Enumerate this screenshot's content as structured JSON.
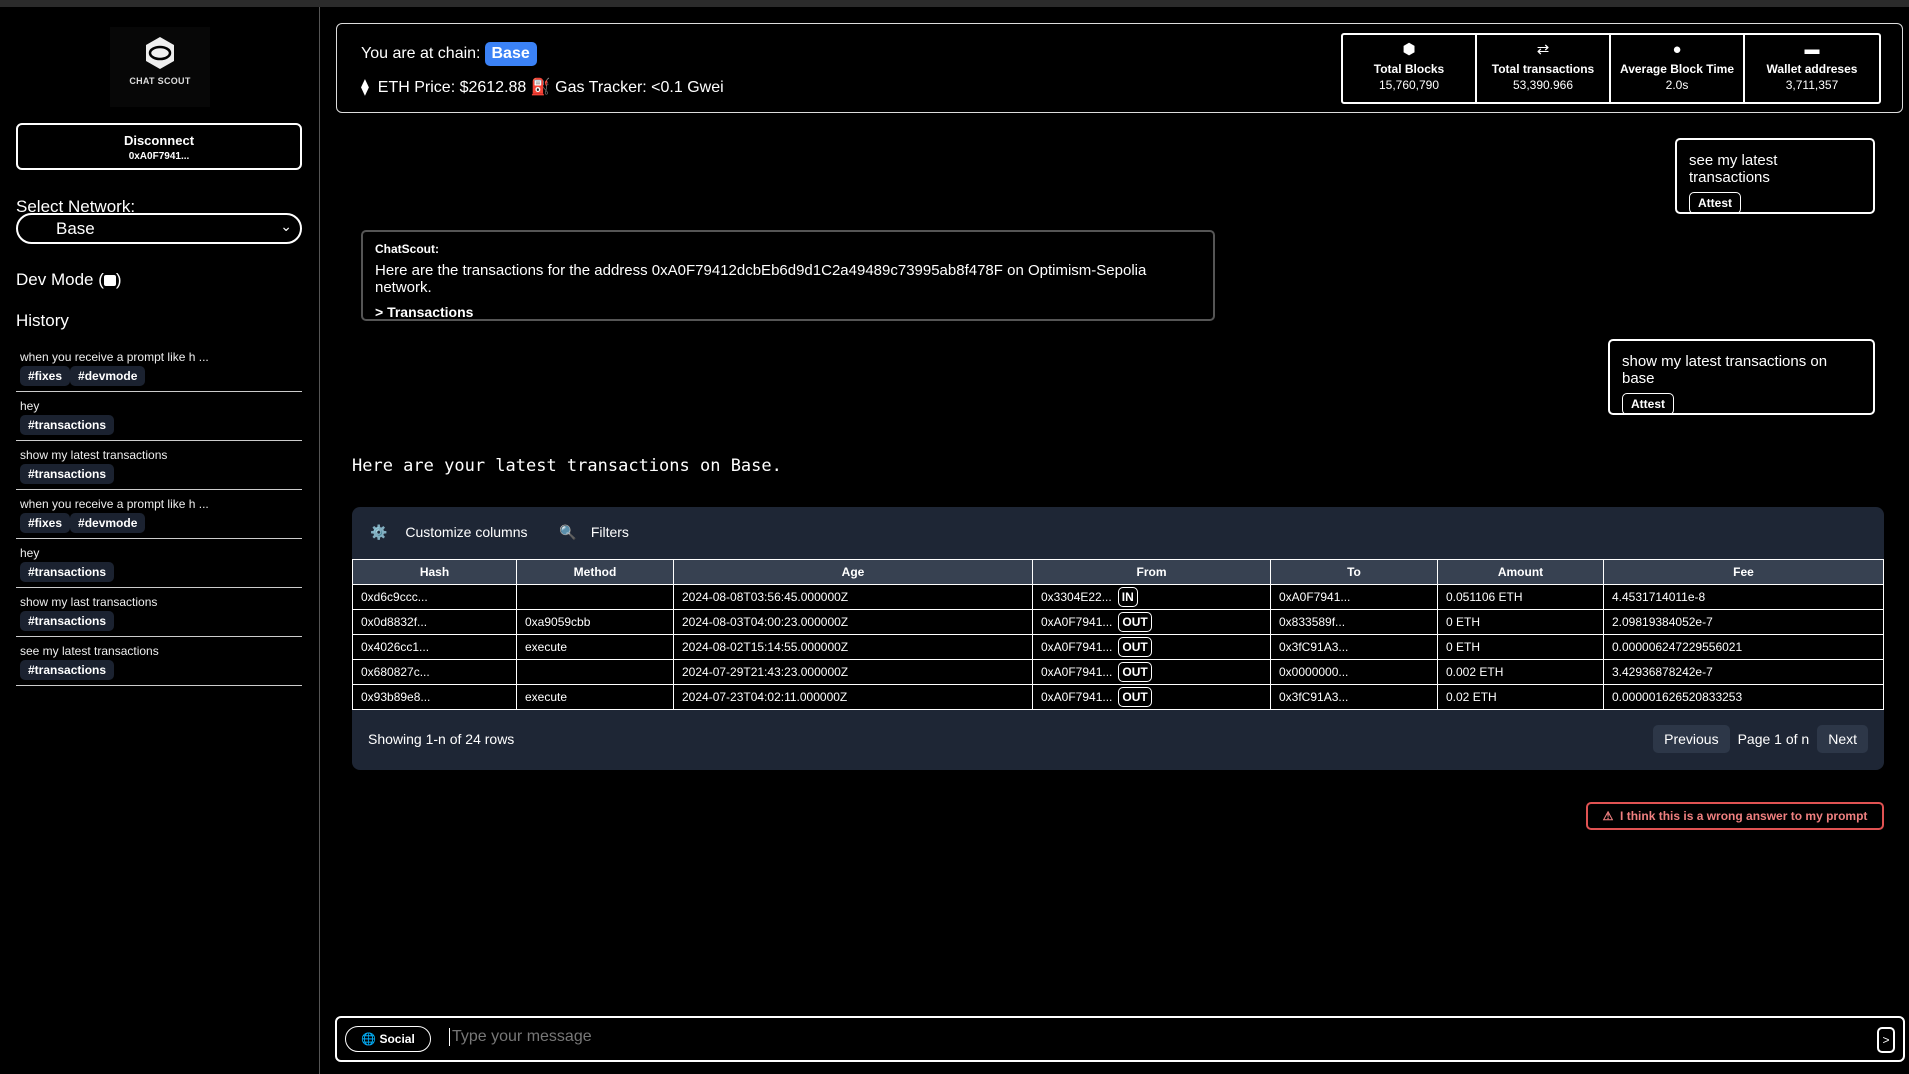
{
  "sidebar": {
    "logo_text": "CHAT SCOUT",
    "disconnect_label": "Disconnect",
    "wallet_short": "0xA0F7941...",
    "network_label": "Select Network:",
    "network_value": "Base",
    "dev_mode_label": "Dev Mode (",
    "dev_mode_close": ")",
    "history_label": "History",
    "history": [
      {
        "text": "when you receive a prompt like h ...",
        "tags": [
          "#fixes",
          "#devmode"
        ]
      },
      {
        "text": "hey",
        "tags": [
          "#transactions"
        ]
      },
      {
        "text": "show my latest transactions",
        "tags": [
          "#transactions"
        ]
      },
      {
        "text": "when you receive a prompt like h ...",
        "tags": [
          "#fixes",
          "#devmode"
        ]
      },
      {
        "text": "hey",
        "tags": [
          "#transactions"
        ]
      },
      {
        "text": "show my last transactions",
        "tags": [
          "#transactions"
        ]
      },
      {
        "text": "see my latest transactions",
        "tags": [
          "#transactions"
        ]
      }
    ]
  },
  "info": {
    "chain_label": "You are at chain:",
    "chain": "Base",
    "chain_color": "#3b82f6",
    "eth_price": "ETH Price: $2612.88",
    "gas": "Gas Tracker: <0.1 Gwei",
    "stats": [
      {
        "icon": "cube-icon",
        "label": "Total Blocks",
        "value": "15,760,790"
      },
      {
        "icon": "arrows-exchange-icon",
        "label": "Total transactions",
        "value": "53,390.966"
      },
      {
        "icon": "clock-icon",
        "label": "Average Block Time",
        "value": "2.0s"
      },
      {
        "icon": "wallet-icon",
        "label": "Wallet addreses",
        "value": "3,711,357"
      }
    ]
  },
  "chat": {
    "user1": "see my latest transactions",
    "user2": "show my latest transactions on base",
    "attest": "Attest",
    "bot_name": "ChatScout:",
    "bot_msg": "Here are the transactions for the address 0xA0F79412dcbEb6d9d1C2a49489c73995ab8f478F on Optimism-Sepolia network.",
    "bot_link": "> Transactions",
    "reply": "Here are your latest transactions on Base."
  },
  "table": {
    "customize": "Customize columns",
    "filters": "Filters",
    "columns": [
      "Hash",
      "Method",
      "Age",
      "From",
      "To",
      "Amount",
      "Fee"
    ],
    "rows": [
      [
        "0xd6c9ccc...",
        "",
        "2024-08-08T03:56:45.000000Z",
        "0x3304E22...",
        "IN",
        "0xA0F7941...",
        "0.051106 ETH",
        "4.4531714011e-8"
      ],
      [
        "0x0d8832f...",
        "0xa9059cbb",
        "2024-08-03T04:00:23.000000Z",
        "0xA0F7941...",
        "OUT",
        "0x833589f...",
        "0 ETH",
        "2.09819384052e-7"
      ],
      [
        "0x4026cc1...",
        "execute",
        "2024-08-02T15:14:55.000000Z",
        "0xA0F7941...",
        "OUT",
        "0x3fC91A3...",
        "0 ETH",
        "0.000006247229556021"
      ],
      [
        "0x680827c...",
        "",
        "2024-07-29T21:43:23.000000Z",
        "0xA0F7941...",
        "OUT",
        "0x0000000...",
        "0.002 ETH",
        "3.42936878242e-7"
      ],
      [
        "0x93b89e8...",
        "execute",
        "2024-07-23T04:02:11.000000Z",
        "0xA0F7941...",
        "OUT",
        "0x3fC91A3...",
        "0.02 ETH",
        "0.000001626520833253"
      ]
    ],
    "showing": "Showing 1-n of 24 rows",
    "previous": "Previous",
    "page": "Page 1 of n",
    "next": "Next"
  },
  "wrong_answer": "I think this is a wrong answer to my prompt",
  "input": {
    "social": "Social",
    "placeholder": "Type your message",
    "send": ">"
  }
}
